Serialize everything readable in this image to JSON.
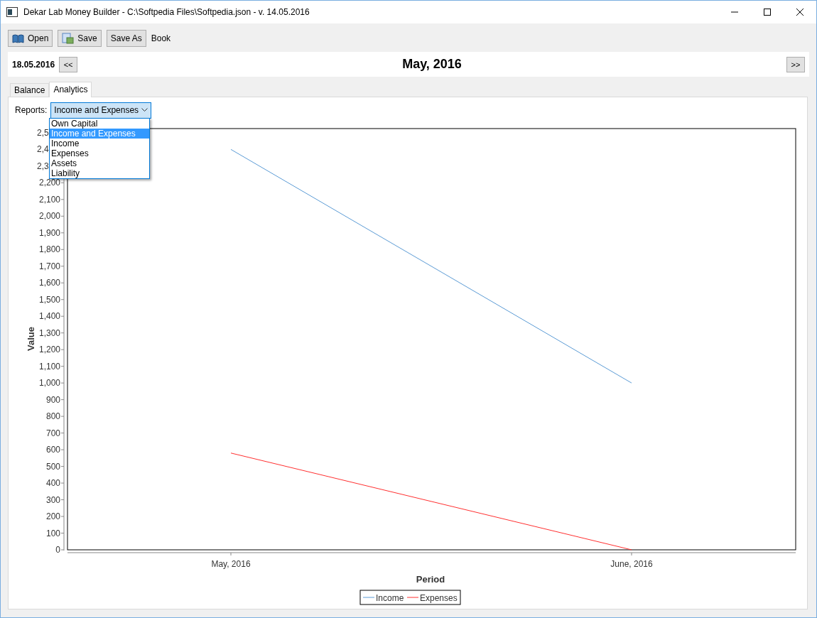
{
  "window": {
    "title": "Dekar Lab Money Builder - C:\\Softpedia Files\\Softpedia.json - v. 14.05.2016"
  },
  "toolbar": {
    "buttons": [
      {
        "label": "Open",
        "kind": "open"
      },
      {
        "label": "Save",
        "kind": "save"
      },
      {
        "label": "Save As",
        "kind": "plain"
      }
    ],
    "book_label": "Book"
  },
  "period_bar": {
    "date": "18.05.2016",
    "prev": "<<",
    "title": "May, 2016",
    "next": ">>"
  },
  "tabs": [
    {
      "label": "Balance",
      "selected": false
    },
    {
      "label": "Analytics",
      "selected": true
    }
  ],
  "reports": {
    "label": "Reports:",
    "value": "Income and Expenses",
    "expanded": true,
    "options": [
      {
        "label": "Own Capital",
        "selected": false
      },
      {
        "label": "Income and Expenses",
        "selected": true
      },
      {
        "label": "Income",
        "selected": false
      },
      {
        "label": "Expenses",
        "selected": false
      },
      {
        "label": "Assets",
        "selected": false
      },
      {
        "label": "Liability",
        "selected": false
      }
    ]
  },
  "chart_data": {
    "type": "line",
    "xlabel": "Period",
    "ylabel": "Value",
    "categories": [
      "May, 2016",
      "June, 2016"
    ],
    "series": [
      {
        "name": "Income",
        "color": "#5b9bd5",
        "values": [
          2400,
          1000
        ]
      },
      {
        "name": "Expenses",
        "color": "#ff3030",
        "values": [
          580,
          0
        ]
      }
    ],
    "ylim": [
      0,
      2525
    ],
    "legend": true,
    "yticks": [
      0,
      100,
      200,
      300,
      400,
      500,
      600,
      700,
      800,
      900,
      {
        "value": 1000,
        "label": "1,000"
      },
      {
        "value": 1100,
        "label": "1,100"
      },
      {
        "value": 1200,
        "label": "1,200"
      },
      {
        "value": 1300,
        "label": "1,300"
      },
      {
        "value": 1400,
        "label": "1,400"
      },
      {
        "value": 1500,
        "label": "1,500"
      },
      {
        "value": 1600,
        "label": "1,600"
      },
      {
        "value": 1700,
        "label": "1,700"
      },
      {
        "value": 1800,
        "label": "1,800"
      },
      {
        "value": 1900,
        "label": "1,900"
      },
      {
        "value": 2000,
        "label": "2,000"
      },
      {
        "value": 2100,
        "label": "2,100"
      },
      {
        "value": 2200,
        "label": "2,200"
      }
    ]
  },
  "partly_covered_tick_labels": [
    "2,5",
    "2,4",
    "2,3"
  ]
}
